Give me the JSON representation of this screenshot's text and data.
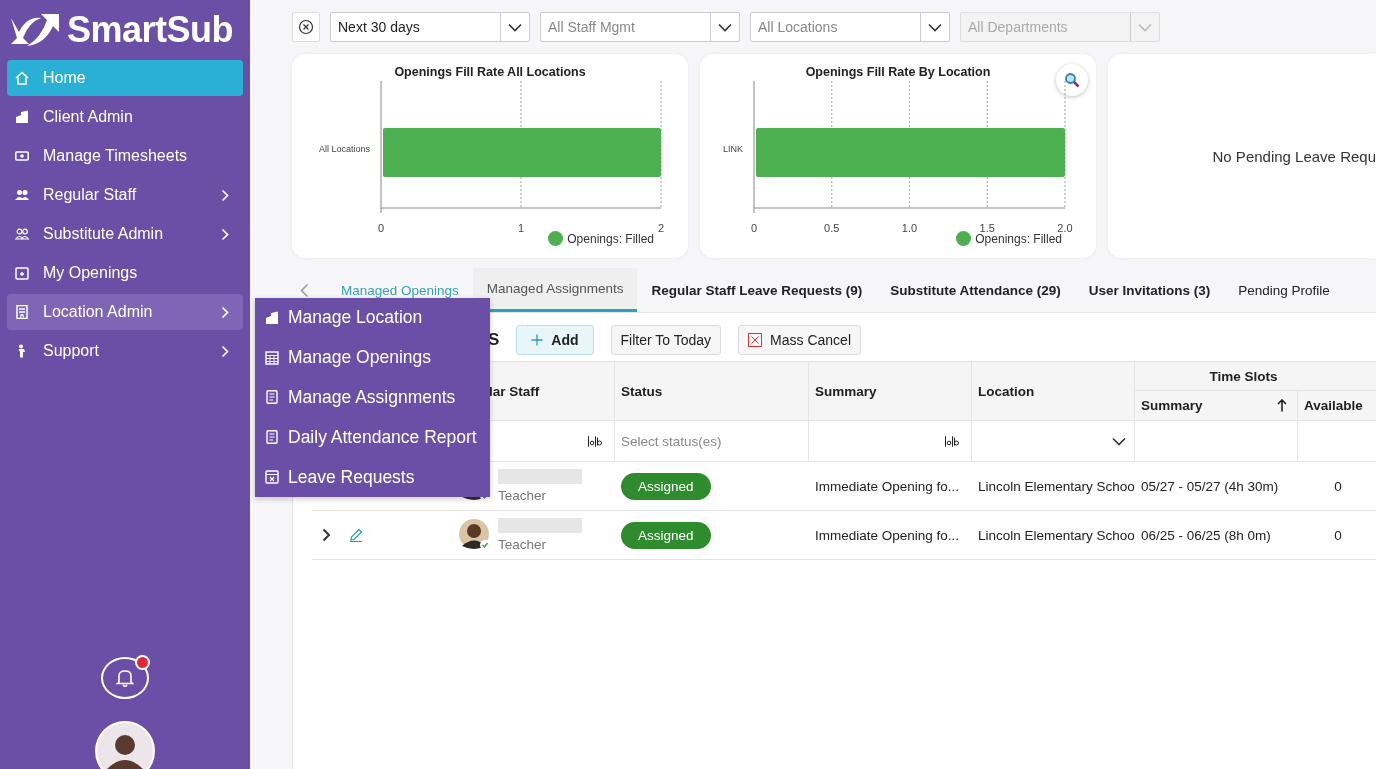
{
  "sidebar": {
    "logo": "SmartSub",
    "items": [
      {
        "label": "Home",
        "selected": true,
        "expandable": false,
        "expanded": false
      },
      {
        "label": "Client Admin",
        "selected": false,
        "expandable": false,
        "expanded": false
      },
      {
        "label": "Manage Timesheets",
        "selected": false,
        "expandable": false,
        "expanded": false
      },
      {
        "label": "Regular Staff",
        "selected": false,
        "expandable": true,
        "expanded": false
      },
      {
        "label": "Substitute Admin",
        "selected": false,
        "expandable": true,
        "expanded": false
      },
      {
        "label": "My Openings",
        "selected": false,
        "expandable": false,
        "expanded": false
      },
      {
        "label": "Location Admin",
        "selected": false,
        "expandable": true,
        "expanded": true
      },
      {
        "label": "Support",
        "selected": false,
        "expandable": true,
        "expanded": false
      }
    ],
    "notifications": {
      "unread": true
    }
  },
  "submenu": [
    {
      "label": "Manage Location"
    },
    {
      "label": "Manage Openings"
    },
    {
      "label": "Manage Assignments"
    },
    {
      "label": "Daily Attendance Report"
    },
    {
      "label": "Leave Requests"
    }
  ],
  "filters": [
    {
      "value": "Next 30 days",
      "disabled": false
    },
    {
      "placeholder": "All Staff Mgmt",
      "disabled": false
    },
    {
      "placeholder": "All Locations",
      "disabled": false
    },
    {
      "placeholder": "All Departments",
      "disabled": true
    }
  ],
  "cards": [
    {
      "title": "Openings Fill Rate All Locations",
      "zoom": false,
      "chart_data": {
        "type": "bar",
        "orientation": "horizontal",
        "grid": true,
        "categories": [
          "All Locations"
        ],
        "series": [
          {
            "name": "Openings: Filled",
            "color": "#4caf50",
            "values": [
              2
            ]
          }
        ],
        "xlim": [
          0,
          2
        ],
        "xticks": [
          0,
          1,
          2
        ]
      }
    },
    {
      "title": "Openings Fill Rate By Location",
      "zoom": true,
      "chart_data": {
        "type": "bar",
        "orientation": "horizontal",
        "grid": true,
        "categories": [
          "LINK"
        ],
        "series": [
          {
            "name": "Openings: Filled",
            "color": "#4caf50",
            "values": [
              2
            ]
          }
        ],
        "xlim": [
          0,
          2
        ],
        "xticks": [
          0,
          {
            "value": 0.5,
            "label": "0.5"
          },
          {
            "value": 1,
            "label": "1.0"
          },
          {
            "value": 1.5,
            "label": "1.5"
          },
          {
            "value": 2,
            "label": "2.0"
          }
        ]
      }
    }
  ],
  "leave_card": {
    "message": "No Pending Leave Requ"
  },
  "tabs": [
    {
      "label": "Managed Openings",
      "kind": "link",
      "selected": false
    },
    {
      "label": "Managed Assignments",
      "kind": "plain",
      "selected": true
    },
    {
      "label": "Regular Staff Leave Requests (9)",
      "kind": "count",
      "selected": false
    },
    {
      "label": "Substitute Attendance (29)",
      "kind": "count",
      "selected": false
    },
    {
      "label": "User Invitations (3)",
      "kind": "count",
      "selected": false
    },
    {
      "label": "Pending Profile",
      "kind": "plain",
      "selected": false
    }
  ],
  "section": {
    "title": "S",
    "buttons": [
      {
        "label": "Add",
        "kind": "add"
      },
      {
        "label": "Filter To Today",
        "kind": "plain"
      },
      {
        "label": "Mass Cancel",
        "kind": "cancel"
      }
    ]
  },
  "table": {
    "columns": {
      "staff": "lar Staff",
      "status": "Status",
      "summary": "Summary",
      "location": "Location",
      "time_slots": "Time Slots",
      "slot_summary": "Summary",
      "available": "Available"
    },
    "status_filter": {
      "placeholder": "Select status(es)"
    },
    "rows": [
      {
        "role": "Teacher",
        "status": "Assigned",
        "summary": "Immediate Opening fo...",
        "location": "Lincoln Elementary Schoo",
        "slots": "05/27 - 05/27 (4h 30m)",
        "available": "0"
      },
      {
        "expander": true,
        "role": "Teacher",
        "status": "Assigned",
        "summary": "Immediate Opening fo...",
        "location": "Lincoln Elementary Schoo",
        "slots": "06/25 - 06/25 (8h 0m)",
        "available": "0"
      }
    ]
  }
}
